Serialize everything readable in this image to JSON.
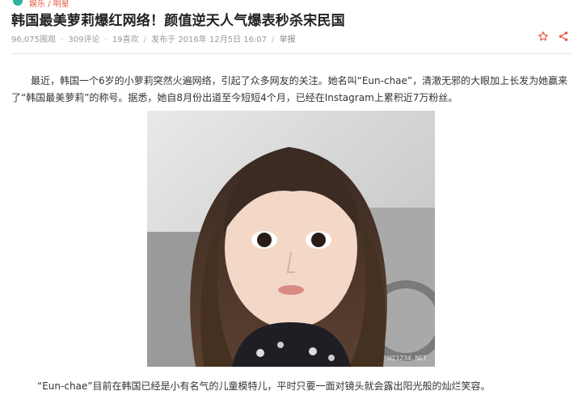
{
  "header": {
    "category": "娱乐 / 明星",
    "title": "韩国最美萝莉爆红网络！颜值逆天人气爆表秒杀宋民国"
  },
  "meta": {
    "views": "96,075围观",
    "comments": "309评论",
    "likes": "19喜欢",
    "published": "发布于 2016年 12月5日 16:07",
    "report": "举报"
  },
  "article": {
    "paragraph1": "最近，韩国一个6岁的小萝莉突然火遍网络，引起了众多网友的关注。她名叫“Eun-chae”，清澈无邪的大眼加上长发为她赢来了“韩国最美萝莉”的称号。据悉，她自8月份出道至今短短4个月，已经在Instagram上累积近7万粉丝。",
    "paragraph2": "“Eun-chae”目前在韩国已经是小有名气的儿童模特儿，平时只要一面对镜头就会露出阳光般的灿烂笑容。",
    "photo_watermark": "UI1234.NET"
  },
  "icons": {
    "favorite": "star-outline-icon",
    "share": "share-icon"
  },
  "colors": {
    "accent": "#e8563f",
    "brand": "#2bb39b"
  }
}
